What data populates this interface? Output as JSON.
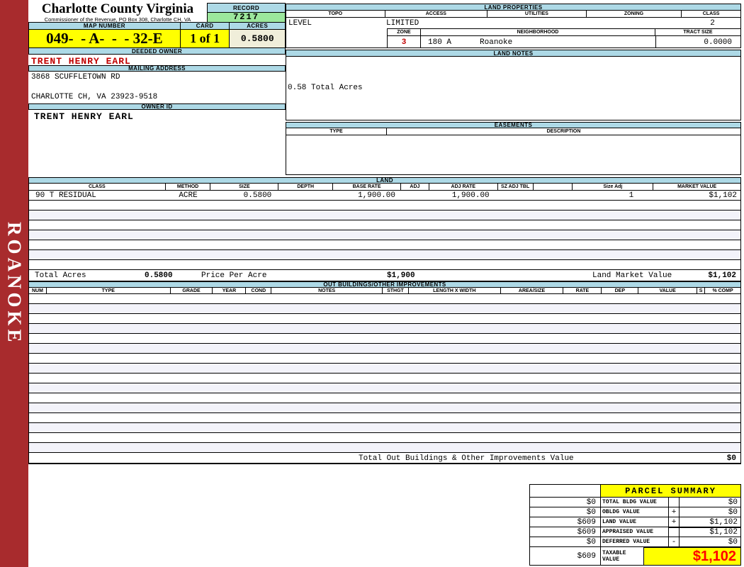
{
  "colors": {
    "sidebar_red": "#A82B2D",
    "header_blue": "#ADD9E6",
    "highlight_yellow": "#FFFF00",
    "record_green": "#9CE79C",
    "acres_cream": "#F0EEDA",
    "owner_red": "#C00000",
    "taxable_red": "#FF0000"
  },
  "sidebar": {
    "vertical_text": "ROANOKE"
  },
  "header": {
    "county_title": "Charlotte County Virginia",
    "county_subtitle": "Commissioner of the Revenue, PO Box 308, Charlotte CH, VA",
    "record_label": "RECORD",
    "record_value": "7217",
    "map_number_label": "MAP NUMBER",
    "map_number_value": "049-  - A-  -  - 32-E",
    "card_label": "CARD",
    "card_value": "1 of 1",
    "acres_label": "ACRES",
    "acres_value": "0.5800"
  },
  "owner": {
    "deeded_owner_label": "DEEDED OWNER",
    "deeded_owner": "TRENT HENRY EARL",
    "mailing_address_label": "MAILING ADDRESS",
    "address_line1": "3868 SCUFFLETOWN RD",
    "address_line2": "CHARLOTTE CH, VA 23923-9518",
    "owner_id_label": "OWNER ID",
    "owner_id": "TRENT HENRY EARL"
  },
  "land_properties": {
    "section_label": "LAND PROPERTIES",
    "headers": [
      "TOPO",
      "ACCESS",
      "UTILITIES",
      "ZONING",
      "CLASS"
    ],
    "topo_value": "LEVEL",
    "access_value": "LIMITED",
    "class_value": "2",
    "zone_label": "ZONE",
    "zone_value": "3",
    "neighborhood_label": "NEIGHBORHOOD",
    "neighborhood_code": "180 A",
    "neighborhood_name": "Roanoke",
    "tract_size_label": "TRACT SIZE",
    "tract_size_value": "0.0000"
  },
  "land_notes": {
    "section_label": "LAND NOTES",
    "note": "0.58 Total Acres"
  },
  "easements": {
    "section_label": "EASEMENTS",
    "type_label": "TYPE",
    "description_label": "DESCRIPTION"
  },
  "land": {
    "section_label": "LAND",
    "headers": [
      "CLASS",
      "METHOD",
      "SIZE",
      "DEPTH",
      "BASE RATE",
      "ADJ",
      "ADJ RATE",
      "SZ ADJ TBL",
      "",
      "Size Adj",
      "MARKET VALUE"
    ],
    "rows": [
      [
        "90 T RESIDUAL",
        "ACRE",
        "0.5800",
        "",
        "1,900.00",
        "",
        "1,900.00",
        "",
        "",
        "1",
        "$1,102"
      ]
    ],
    "total_acres_label": "Total Acres",
    "total_acres_value": "0.5800",
    "price_per_acre_label": "Price Per Acre",
    "price_per_acre_value": "$1,900",
    "land_market_value_label": "Land Market Value",
    "land_market_value": "$1,102"
  },
  "out_buildings": {
    "section_label": "OUT BUILDINGS/OTHER IMPROVEMENTS",
    "headers": [
      "NUM",
      "TYPE",
      "GRADE",
      "YEAR",
      "COND",
      "NOTES",
      "STHGT",
      "LENGTH X WIDTH",
      "AREA/SIZE",
      "RATE",
      "DEP",
      "VALUE",
      "S",
      "% COMP"
    ],
    "total_label": "Total Out Buildings & Other Improvements Value",
    "total_value": "$0"
  },
  "parcel_summary": {
    "title": "PARCEL SUMMARY",
    "rows": [
      {
        "prior": "$0",
        "label": "TOTAL BLDG VALUE",
        "op": "",
        "value": "$0"
      },
      {
        "prior": "$0",
        "label": "OBLDG VALUE",
        "op": "+",
        "value": "$0"
      },
      {
        "prior": "$609",
        "label": "LAND VALUE",
        "op": "+",
        "value": "$1,102"
      },
      {
        "prior": "$609",
        "label": "APPRAISED VALUE",
        "op": "",
        "value": "$1,102"
      },
      {
        "prior": "$0",
        "label": "DEFERRED VALUE",
        "op": "-",
        "value": "$0"
      }
    ],
    "taxable_prior": "$609",
    "taxable_label": "TAXABLE VALUE",
    "taxable_value": "$1,102"
  }
}
